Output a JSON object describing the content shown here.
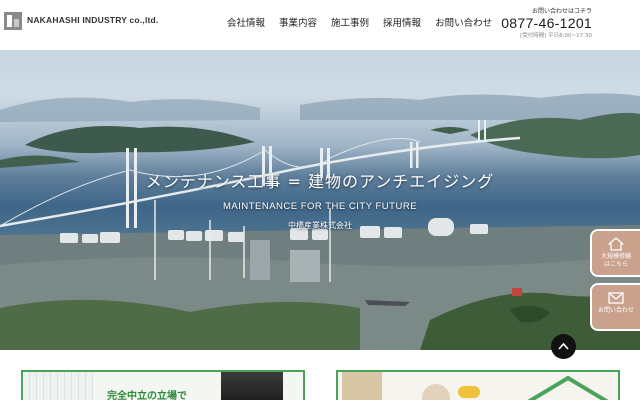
{
  "header": {
    "company_name": "NAKAHASHI INDUSTRY co.,ltd.",
    "nav": [
      "会社情報",
      "事業内容",
      "施工事例",
      "採用情報",
      "お問い合わせ"
    ],
    "contact_caption": "お問い合わせはコチラ",
    "phone": "0877-46-1201",
    "hours": "[受付時間] 平日8:00~17:30"
  },
  "hero": {
    "title": "メンテナンス工事 = 建物のアンチエイジング",
    "subtitle": "MAINTENANCE FOR THE CITY FUTURE",
    "company_jp": "中橋産業株式会社"
  },
  "side_buttons": [
    {
      "icon": "house-icon",
      "label_line1": "大規模修繕",
      "label_line2": "はこちら"
    },
    {
      "icon": "mail-icon",
      "label_line1": "お問い合わせ"
    }
  ],
  "cards": {
    "left_text": "完全中立の立場で"
  },
  "colors": {
    "accent_green": "#49a35a",
    "side_button": "#c9a18c",
    "scroll_top": "#111111"
  }
}
